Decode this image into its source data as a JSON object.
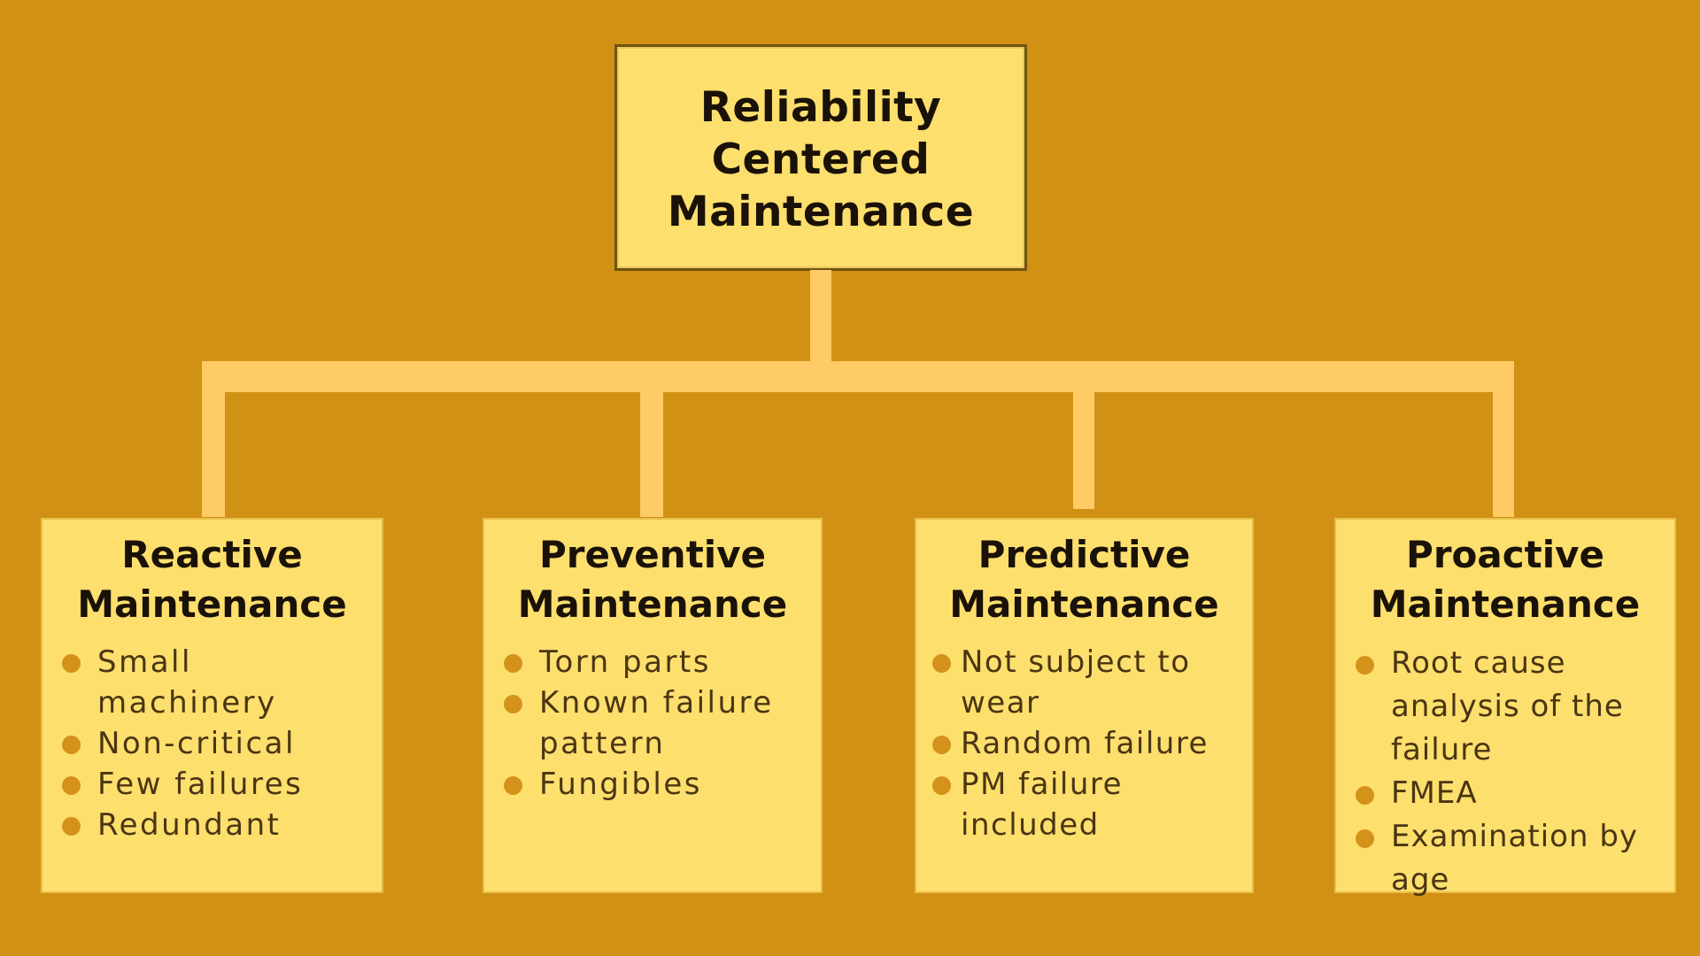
{
  "root": {
    "title": "Reliability\nCentered\nMaintenance"
  },
  "colors": {
    "background": "#D19114",
    "box_fill": "#FDDF6E",
    "connector": "#FFCB66",
    "bullet": "#D4921A",
    "title_text": "#1A1208",
    "body_text": "#4A3512"
  },
  "children": [
    {
      "title": "Reactive\nMaintenance",
      "items": [
        "Small machinery",
        "Non-critical",
        "Few failures",
        "Redundant"
      ]
    },
    {
      "title": "Preventive\nMaintenance",
      "items": [
        "Torn parts",
        "Known failure pattern",
        "Fungibles"
      ]
    },
    {
      "title": "Predictive\nMaintenance",
      "items": [
        "Not subject to wear",
        "Random failure",
        "PM failure included"
      ]
    },
    {
      "title": "Proactive\nMaintenance",
      "items": [
        "Root cause analysis of the failure",
        "FMEA",
        "Examination by age"
      ]
    }
  ]
}
